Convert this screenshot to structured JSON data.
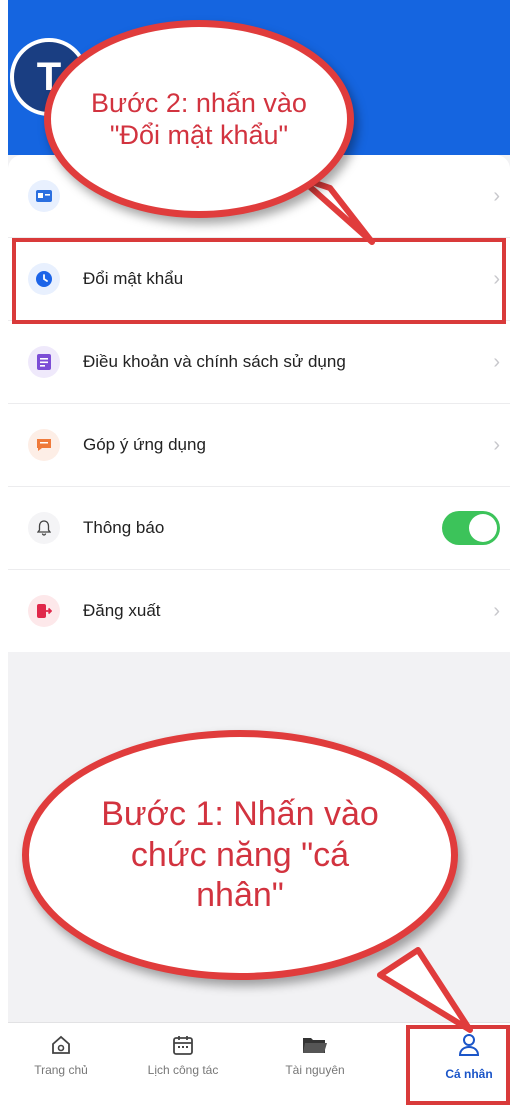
{
  "header": {
    "avatar_initial": "T"
  },
  "menu": {
    "items": [
      {
        "label": "",
        "icon": "id-card-icon",
        "trailing": "chevron"
      },
      {
        "label": "Đổi mật khẩu",
        "icon": "lock-clock-icon",
        "trailing": "chevron"
      },
      {
        "label": "Điều khoản và chính sách sử dụng",
        "icon": "document-icon",
        "trailing": "chevron"
      },
      {
        "label": "Góp ý ứng dụng",
        "icon": "feedback-icon",
        "trailing": "chevron"
      },
      {
        "label": "Thông báo",
        "icon": "bell-icon",
        "trailing": "toggle",
        "toggle_on": true
      },
      {
        "label": "Đăng xuất",
        "icon": "logout-icon",
        "trailing": "chevron"
      }
    ]
  },
  "tabbar": {
    "tabs": [
      {
        "label": "Trang chủ",
        "icon": "home-icon"
      },
      {
        "label": "Lịch công tác",
        "icon": "calendar-icon"
      },
      {
        "label": "Tài nguyên",
        "icon": "folder-icon"
      },
      {
        "label": "Cá nhân",
        "icon": "person-icon",
        "active": true
      }
    ]
  },
  "annotations": {
    "step2": "Bước 2: nhấn vào \"Đổi mật khẩu\"",
    "step1": "Bước 1: Nhấn vào chức năng \"cá nhân\""
  },
  "colors": {
    "brand_blue": "#1565e0",
    "callout_red": "#e03c3c",
    "toggle_green": "#3cc35a"
  }
}
